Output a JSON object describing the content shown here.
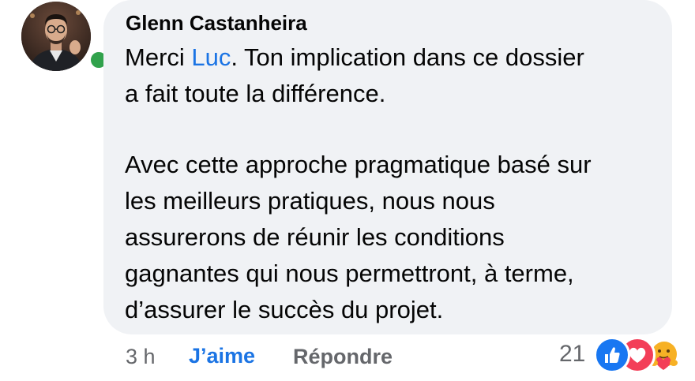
{
  "comment": {
    "author": "Glenn Castanheira",
    "paragraph1": {
      "line1_before": "Merci ",
      "mention": "Luc",
      "line1_after": ". Ton implication dans ce dossier",
      "line2": "a fait toute la différence."
    },
    "paragraph2": [
      "Avec cette approche pragmatique basé sur",
      "les meilleurs pratiques, nous nous",
      "assurerons de réunir les conditions",
      "gagnantes qui nous permettront, à terme,",
      "d’assurer le succès du projet."
    ],
    "author_online": true
  },
  "footer": {
    "time": "3 h",
    "like_label": "J’aime",
    "reply_label": "Répondre",
    "reaction_count": "21",
    "reactions": [
      "like-icon",
      "love-icon",
      "care-icon"
    ]
  },
  "colors": {
    "bubble": "#f0f2f5",
    "link": "#1b74e4",
    "muted": "#65676b",
    "online": "#31a24c",
    "like": "#1877f2",
    "love": "#f33e58"
  }
}
